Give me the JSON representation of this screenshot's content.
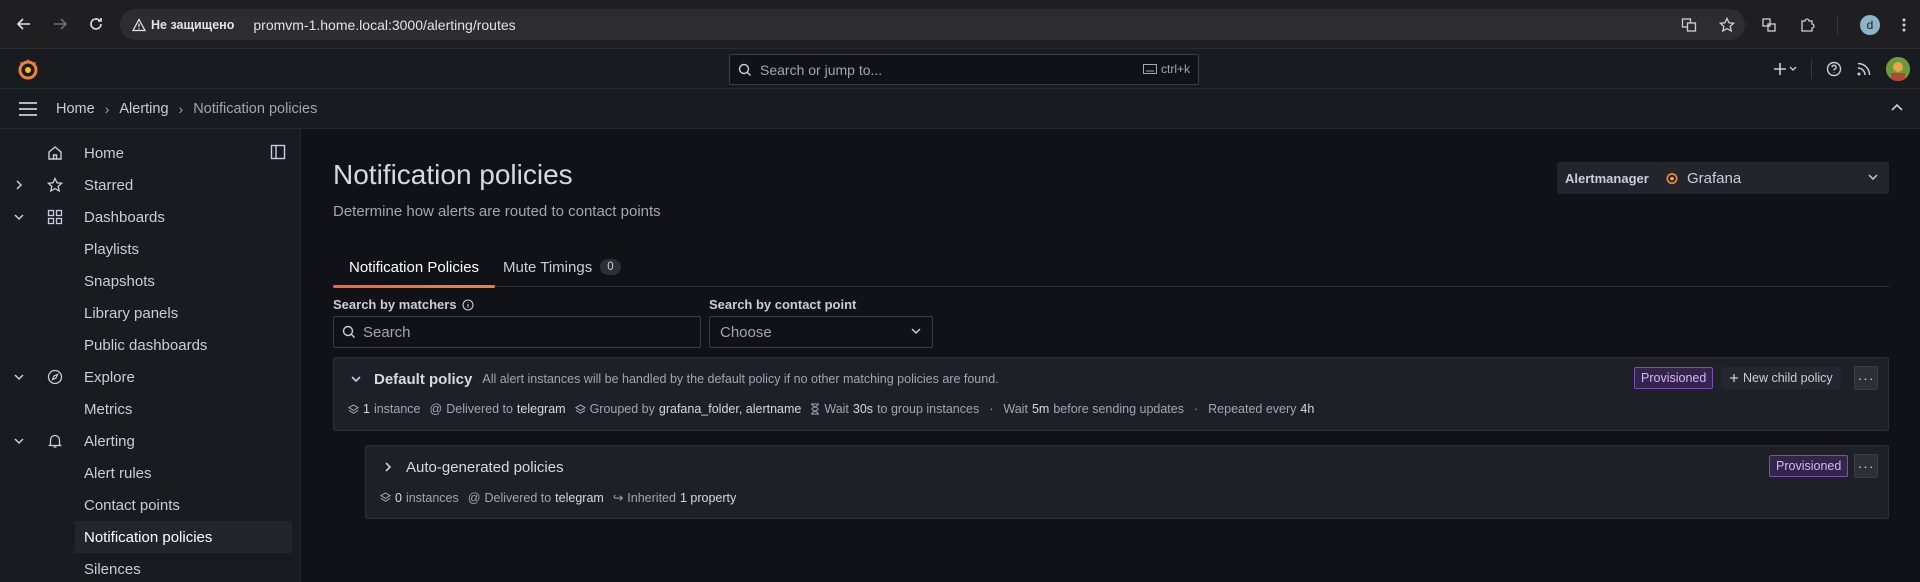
{
  "browser": {
    "security_label": "Не защищено",
    "url": "promvm-1.home.local:3000/alerting/routes",
    "profile_initial": "d"
  },
  "topbar": {
    "search_placeholder": "Search or jump to...",
    "search_shortcut": "ctrl+k"
  },
  "breadcrumb": [
    "Home",
    "Alerting",
    "Notification policies"
  ],
  "sidebar": {
    "items": [
      {
        "label": "Home"
      },
      {
        "label": "Starred"
      },
      {
        "label": "Dashboards"
      },
      {
        "label": "Playlists"
      },
      {
        "label": "Snapshots"
      },
      {
        "label": "Library panels"
      },
      {
        "label": "Public dashboards"
      },
      {
        "label": "Explore"
      },
      {
        "label": "Metrics"
      },
      {
        "label": "Alerting"
      },
      {
        "label": "Alert rules"
      },
      {
        "label": "Contact points"
      },
      {
        "label": "Notification policies"
      },
      {
        "label": "Silences"
      }
    ]
  },
  "page": {
    "title": "Notification policies",
    "subtitle": "Determine how alerts are routed to contact points",
    "alertmanager_label": "Alertmanager",
    "alertmanager_value": "Grafana"
  },
  "tabs": [
    {
      "label": "Notification Policies"
    },
    {
      "label": "Mute Timings",
      "counter": "0"
    }
  ],
  "filters": {
    "matchers_label": "Search by matchers",
    "matchers_placeholder": "Search",
    "contact_label": "Search by contact point",
    "contact_value": "Choose"
  },
  "policies": {
    "default": {
      "name": "Default policy",
      "description": "All alert instances will be handled by the default policy if no other matching policies are found.",
      "badge": "Provisioned",
      "new_child": "New child policy",
      "instances_count": "1",
      "instances_label": "instance",
      "delivered_label": "Delivered to",
      "delivered_value": "telegram",
      "grouped_label": "Grouped by",
      "grouped_value": "grafana_folder, alertname",
      "wait_label": "Wait",
      "wait_value": "30s",
      "wait_suffix": "to group instances",
      "wait2_label": "Wait",
      "wait2_value": "5m",
      "wait2_suffix": "before sending updates",
      "repeat_label": "Repeated every",
      "repeat_value": "4h"
    },
    "auto": {
      "name": "Auto-generated policies",
      "badge": "Provisioned",
      "instances_count": "0",
      "instances_label": "instances",
      "delivered_label": "Delivered to",
      "delivered_value": "telegram",
      "inherited_label": "Inherited",
      "inherited_value": "1 property"
    }
  },
  "colors": {
    "accent": "#f2803d",
    "badge_purple": "#d6b4ff"
  }
}
